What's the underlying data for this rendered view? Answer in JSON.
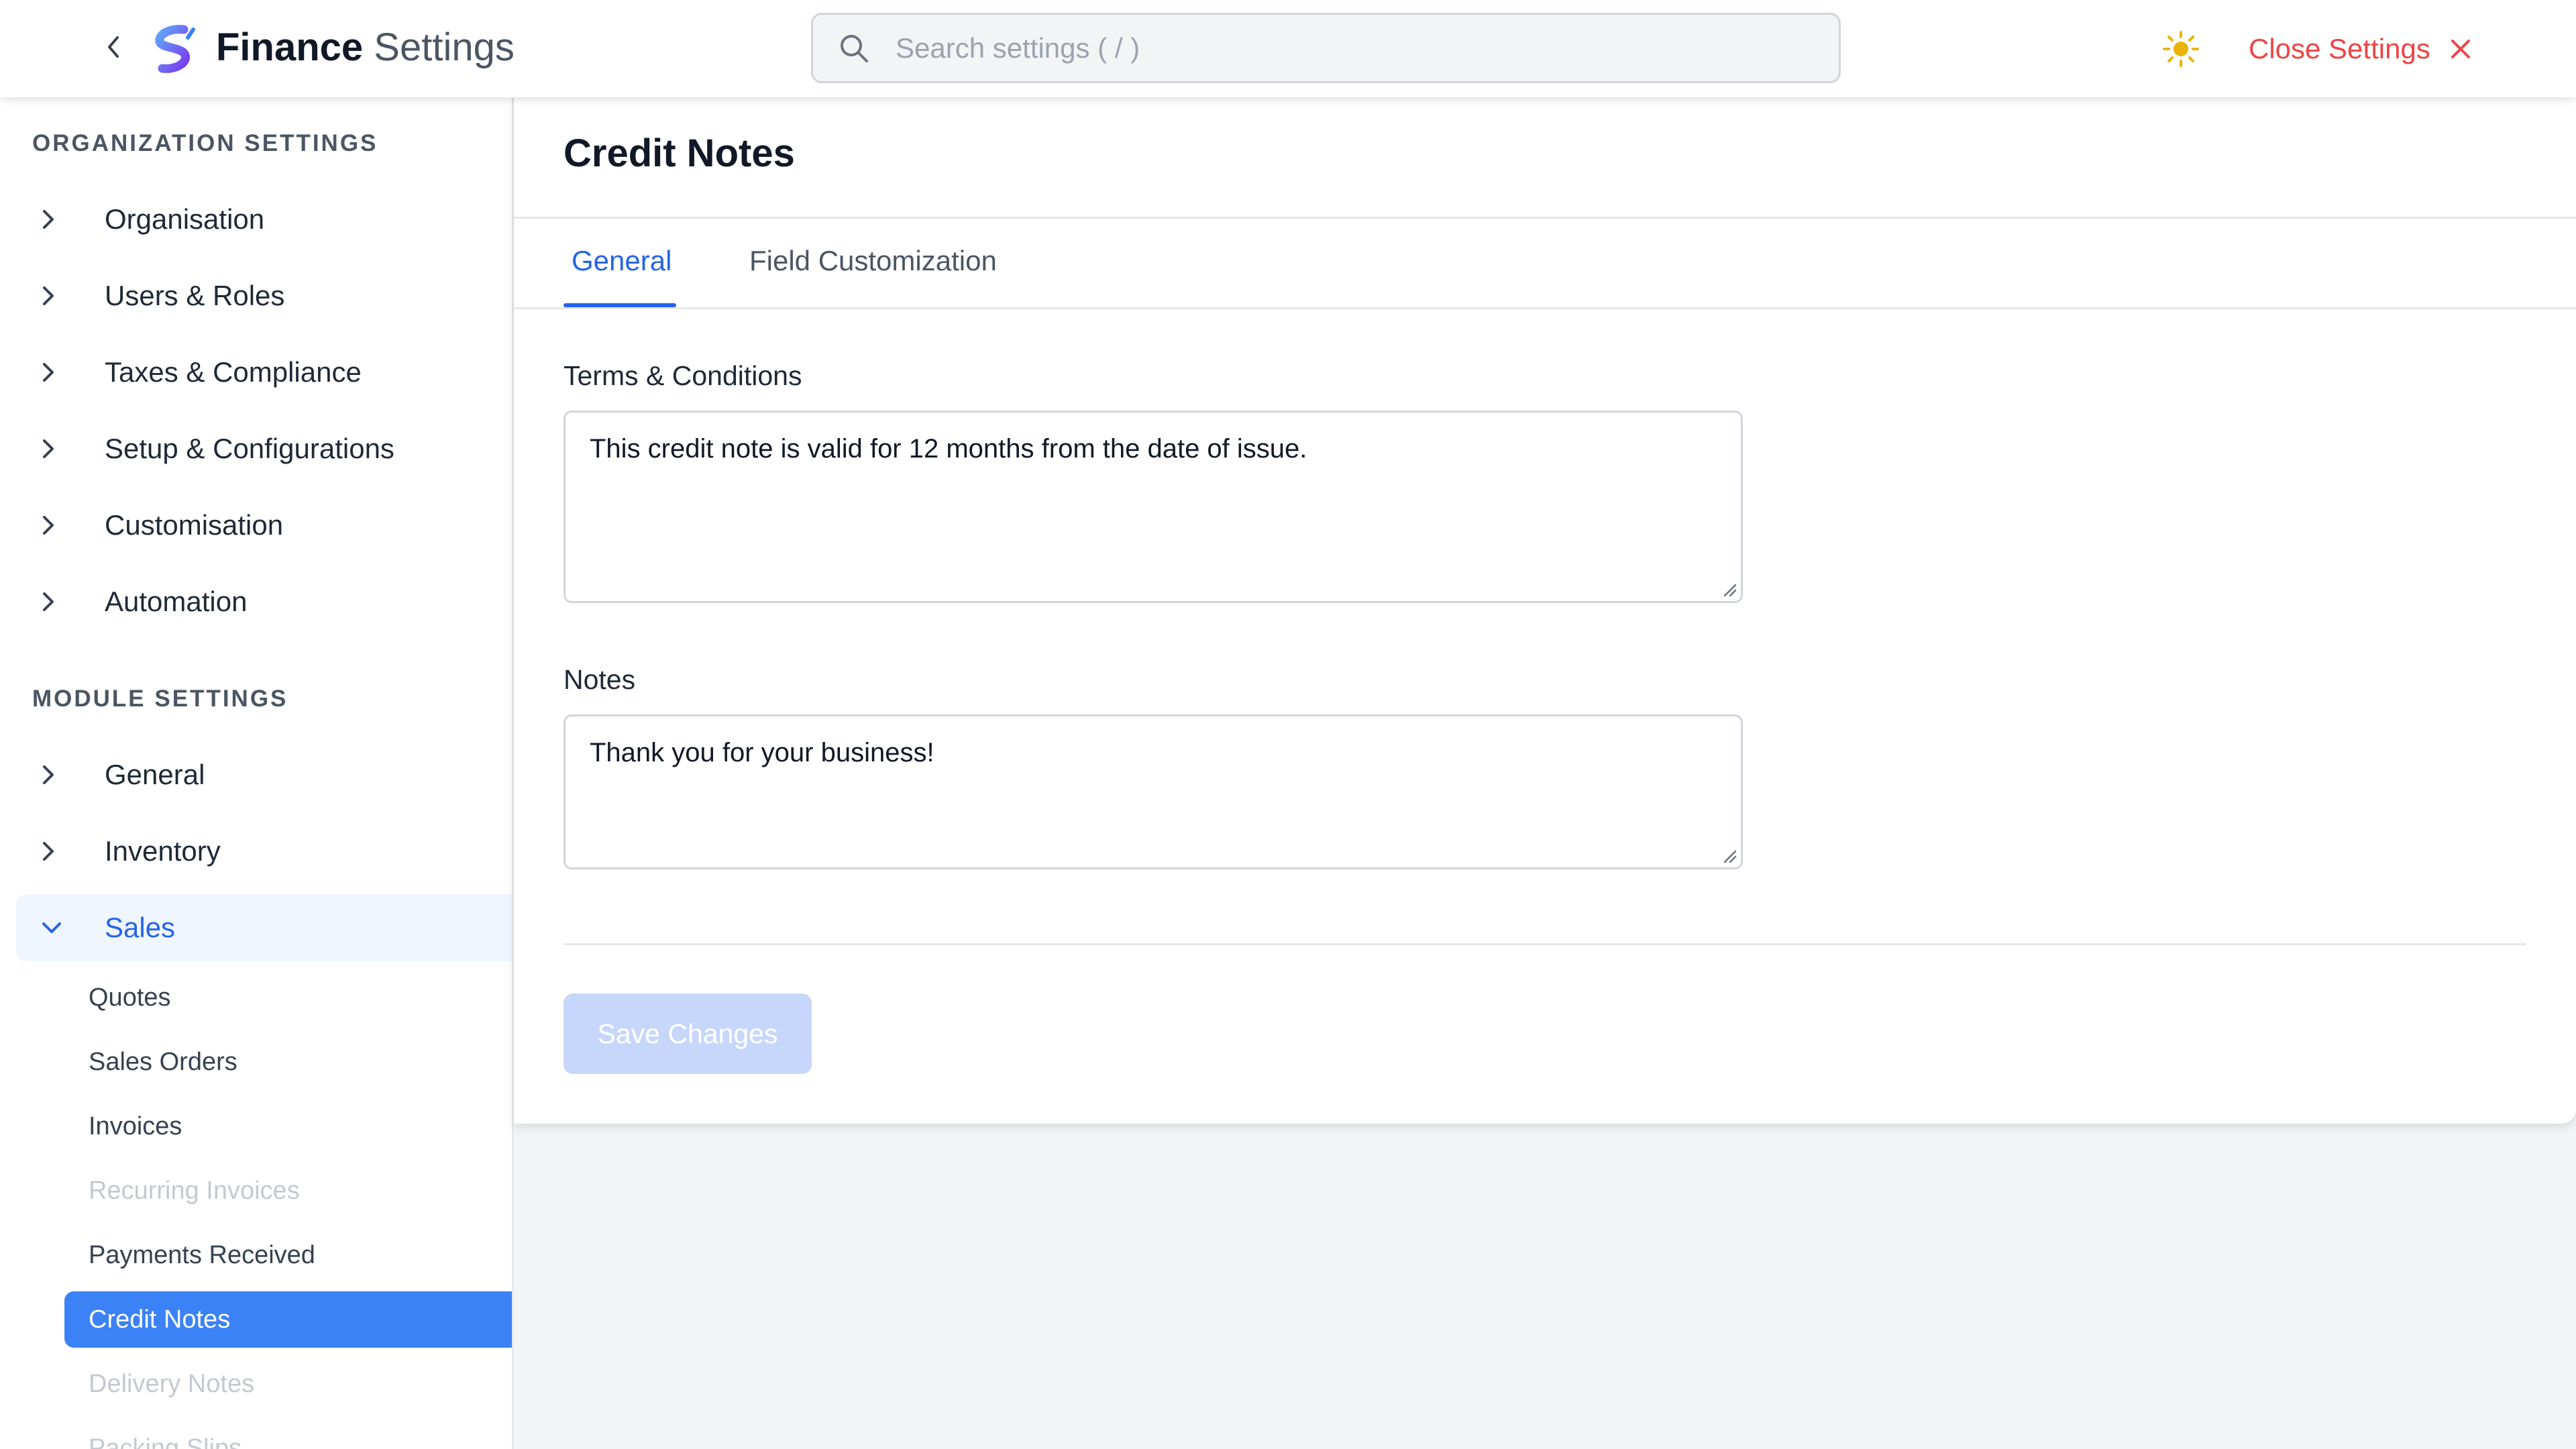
{
  "header": {
    "title_bold": "Finance",
    "title_light": "Settings",
    "search_placeholder": "Search settings ( / )",
    "close_label": "Close Settings",
    "colors": {
      "accent": "#2563eb",
      "danger": "#ef4444",
      "sun": "#eab308"
    }
  },
  "sidebar": {
    "org_heading": "ORGANIZATION SETTINGS",
    "org_items": [
      {
        "label": "Organisation"
      },
      {
        "label": "Users & Roles"
      },
      {
        "label": "Taxes & Compliance"
      },
      {
        "label": "Setup & Configurations"
      },
      {
        "label": "Customisation"
      },
      {
        "label": "Automation"
      }
    ],
    "module_heading": "MODULE SETTINGS",
    "module_items": [
      {
        "label": "General"
      },
      {
        "label": "Inventory"
      },
      {
        "label": "Sales",
        "expanded": true
      }
    ],
    "sales_sub_items": [
      {
        "label": "Quotes"
      },
      {
        "label": "Sales Orders"
      },
      {
        "label": "Invoices"
      },
      {
        "label": "Recurring Invoices",
        "disabled": true
      },
      {
        "label": "Payments Received"
      },
      {
        "label": "Credit Notes",
        "active": true
      },
      {
        "label": "Delivery Notes",
        "disabled": true
      },
      {
        "label": "Packing Slips",
        "disabled": true
      }
    ]
  },
  "main": {
    "page_title": "Credit Notes",
    "tabs": [
      {
        "label": "General",
        "active": true
      },
      {
        "label": "Field Customization"
      }
    ],
    "terms_label": "Terms & Conditions",
    "terms_value": "This credit note is valid for 12 months from the date of issue.",
    "notes_label": "Notes",
    "notes_value": "Thank you for your business!",
    "save_label": "Save Changes"
  }
}
